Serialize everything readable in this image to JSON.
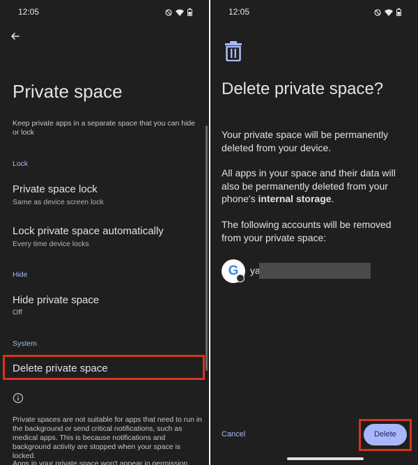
{
  "left_screen": {
    "status_time": "12:05",
    "title": "Private space",
    "description": "Keep private apps in a separate space that you can hide or lock",
    "sections": {
      "lock": "Lock",
      "hide": "Hide",
      "system": "System"
    },
    "items": {
      "private_space_lock": {
        "title": "Private space lock",
        "subtitle": "Same as device screen lock"
      },
      "lock_auto": {
        "title": "Lock private space automatically",
        "subtitle": "Every time device locks"
      },
      "hide_private_space": {
        "title": "Hide private space",
        "subtitle": "Off"
      },
      "delete_private_space": {
        "title": "Delete private space"
      }
    },
    "footer_text": "Private spaces are not suitable for apps that need to run in the background or send critical notifications, such as medical apps. This is because notifications and background activity are stopped when your space is locked.",
    "footer_cut": "Apps in your private space won't appear in permission"
  },
  "right_screen": {
    "status_time": "12:05",
    "title": "Delete private space?",
    "para1": "Your private space will be permanently deleted from your device.",
    "para2_prefix": "All apps in your space and their data will also be permanently deleted from your phone's ",
    "para2_bold": "internal storage",
    "para2_suffix": ".",
    "para3": "The following accounts will be removed from your private space:",
    "account": {
      "icon_letter": "G",
      "name_visible": "ya"
    },
    "cancel_label": "Cancel",
    "delete_label": "Delete"
  },
  "colors": {
    "background": "#1f1f1f",
    "accent": "#a8b7ff",
    "highlight_box": "#d5351f"
  },
  "icons": [
    "back-arrow-icon",
    "dnd-icon",
    "wifi-icon",
    "battery-icon",
    "trash-icon",
    "info-icon",
    "google-icon"
  ]
}
